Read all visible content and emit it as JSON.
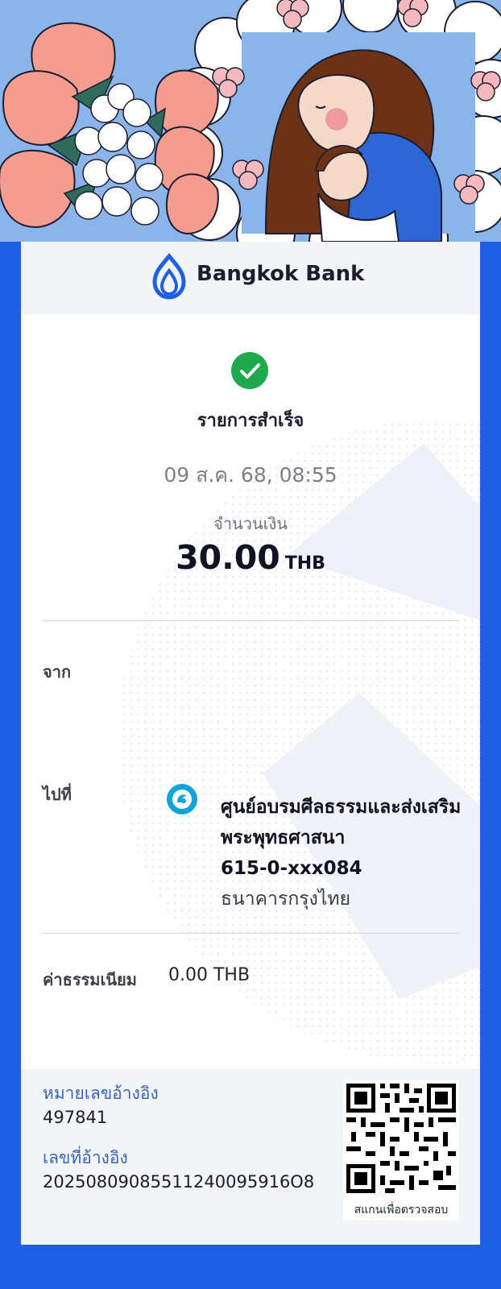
{
  "brand": {
    "name": "Bangkok Bank"
  },
  "transaction": {
    "status": "รายการสำเร็จ",
    "datetime": "09 ส.ค. 68, 08:55",
    "amount_label": "จำนวนเงิน",
    "amount": "30.00",
    "currency": "THB"
  },
  "from": {
    "label": "จาก"
  },
  "to": {
    "label": "ไปที่",
    "name": "ศูนย์อบรมศีลธรรมและส่งเสริมพระพุทธศาสนา",
    "account": "615-0-xxx084",
    "bank": "ธนาคารกรุงไทย"
  },
  "fee": {
    "label": "ค่าธรรมเนียม",
    "value": "0.00 THB"
  },
  "reference": {
    "ref1_label": "หมายเลขอ้างอิง",
    "ref1_value": "497841",
    "ref2_label": "เลขที่อ้างอิง",
    "ref2_value": "20250809085511240095916O8",
    "qr_caption": "สแกนเพื่อตรวจสอบ"
  },
  "icons": {
    "logo": "bangkok-bank-logo",
    "status": "check-circle-icon",
    "bank": "krungthai-bank-icon",
    "qr": "qr-code"
  },
  "colors": {
    "background": "#1f5fe6",
    "brand_blue": "#1f5fe6",
    "success_green": "#1fa84c",
    "link_blue": "#3765b8",
    "krungthai_blue": "#12a3dd"
  }
}
